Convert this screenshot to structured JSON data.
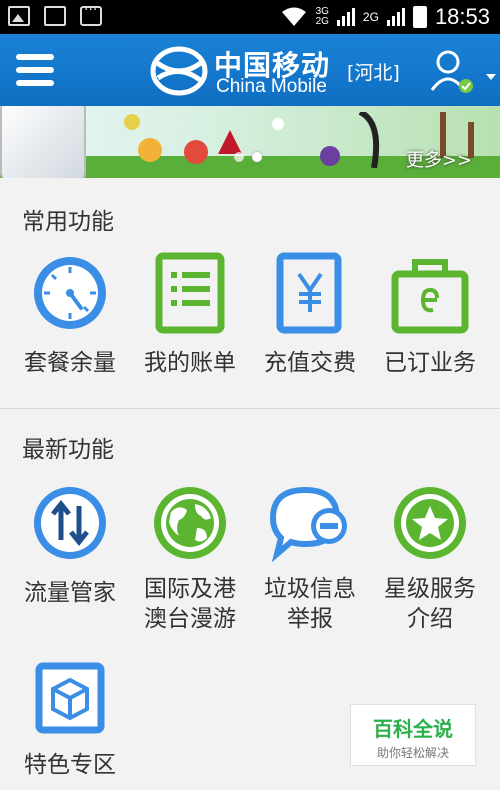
{
  "status_bar": {
    "time": "18:53",
    "net1": "3G",
    "net1b": "2G",
    "net2": "2G"
  },
  "header": {
    "logo_cn": "中国移动",
    "logo_en": "China Mobile",
    "region": "[河北]"
  },
  "banner": {
    "more": "更多>>"
  },
  "sections": {
    "common": {
      "title": "常用功能",
      "items": [
        {
          "label": "套餐余量",
          "icon": "gauge-icon"
        },
        {
          "label": "我的账单",
          "icon": "bill-list-icon"
        },
        {
          "label": "充值交费",
          "icon": "yuan-payment-icon"
        },
        {
          "label": "已订业务",
          "icon": "shopping-bag-icon"
        }
      ]
    },
    "new": {
      "title": "最新功能",
      "items": [
        {
          "label": "流量管家",
          "label2": "",
          "icon": "data-traffic-icon"
        },
        {
          "label": "国际及港",
          "label2": "澳台漫游",
          "icon": "globe-icon"
        },
        {
          "label": "垃圾信息",
          "label2": "举报",
          "icon": "spam-report-icon"
        },
        {
          "label": "星级服务",
          "label2": "介绍",
          "icon": "star-service-icon"
        },
        {
          "label": "特色专区",
          "label2": "",
          "icon": "cube-icon"
        }
      ]
    }
  },
  "watermark": {
    "title": "百科全说",
    "subtitle": "助你轻松解决"
  },
  "colors": {
    "brand_blue": "#1a82d6",
    "green": "#5cb530",
    "icon_blue": "#3a8ee6"
  }
}
